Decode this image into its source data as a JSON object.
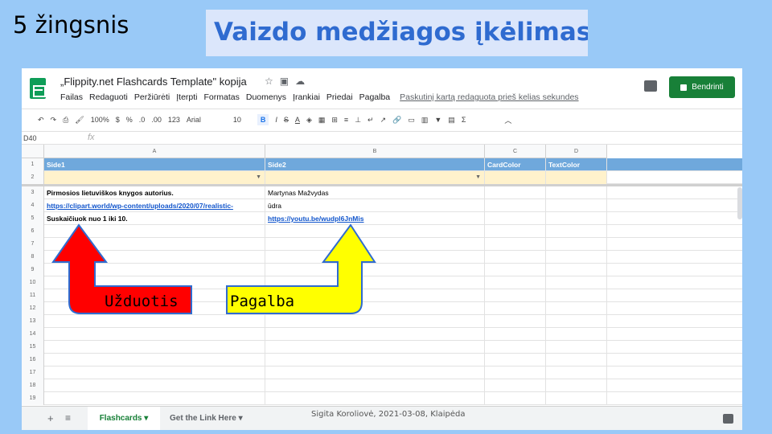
{
  "slide": {
    "step": "5 žingsnis",
    "title": "Vaizdo medžiagos įkėlimas",
    "footer": "Sigita Koroliovė, 2021-03-08, Klaipėda",
    "arrow_left_label": "Užduotis",
    "arrow_right_label": "Pagalba",
    "colors": {
      "background": "#99c9f7",
      "title_box": "#dbe6fb",
      "title_text": "#2f6bd0",
      "arrow_left": "#ff0000",
      "arrow_right": "#ffff00"
    }
  },
  "sheets": {
    "doc_title": "„Flippity.net Flashcards Template\" kopija",
    "title_icons": [
      "star-icon",
      "move-icon",
      "cloud-icon"
    ],
    "menu": [
      "Failas",
      "Redaguoti",
      "Peržiūrėti",
      "Įterpti",
      "Formatas",
      "Duomenys",
      "Įrankiai",
      "Priedai",
      "Pagalba"
    ],
    "last_edit": "Paskutinį kartą redaguota prieš kelias sekundes",
    "share_label": "Bendrinti",
    "toolbar": {
      "zoom": "100%",
      "currency": "$",
      "percent": "%",
      "dec_less": ".0",
      "dec_more": ".00",
      "format_more": "123",
      "font": "Arial",
      "font_size": "10",
      "bold": "B",
      "strike": "S",
      "text_color": "A",
      "sum": "Σ"
    },
    "name_box": "D40",
    "fx": "fx",
    "columns": [
      "A",
      "B",
      "C",
      "D"
    ],
    "header_row": {
      "num": "1",
      "cells": [
        "Side1",
        "Side2",
        "CardColor",
        "TextColor"
      ]
    },
    "rows": [
      {
        "num": "2",
        "cells": [
          "",
          "",
          "",
          ""
        ]
      },
      {
        "num": "3",
        "cells": [
          "Pirmosios lietuviškos knygos autorius.",
          "Martynas Mažvydas",
          "",
          ""
        ]
      },
      {
        "num": "4",
        "cells": [
          "https://clipart.world/wp-content/uploads/2020/07/realistic-",
          "ūdra",
          "",
          ""
        ]
      },
      {
        "num": "5",
        "cells": [
          "Suskaičiuok nuo 1 iki 10.",
          "https://youtu.be/wudpl6JnMis",
          "",
          ""
        ]
      },
      {
        "num": "6",
        "cells": [
          "",
          "",
          "",
          ""
        ]
      },
      {
        "num": "7",
        "cells": [
          "",
          "",
          "",
          ""
        ]
      },
      {
        "num": "8",
        "cells": [
          "",
          "",
          "",
          ""
        ]
      },
      {
        "num": "9",
        "cells": [
          "",
          "",
          "",
          ""
        ]
      },
      {
        "num": "10",
        "cells": [
          "",
          "",
          "",
          ""
        ]
      },
      {
        "num": "11",
        "cells": [
          "",
          "",
          "",
          ""
        ]
      },
      {
        "num": "12",
        "cells": [
          "",
          "",
          "",
          ""
        ]
      },
      {
        "num": "13",
        "cells": [
          "",
          "",
          "",
          ""
        ]
      },
      {
        "num": "14",
        "cells": [
          "",
          "",
          "",
          ""
        ]
      },
      {
        "num": "15",
        "cells": [
          "",
          "",
          "",
          ""
        ]
      },
      {
        "num": "16",
        "cells": [
          "",
          "",
          "",
          ""
        ]
      },
      {
        "num": "17",
        "cells": [
          "",
          "",
          "",
          ""
        ]
      },
      {
        "num": "18",
        "cells": [
          "",
          "",
          "",
          ""
        ]
      },
      {
        "num": "19",
        "cells": [
          "",
          "",
          "",
          ""
        ]
      }
    ],
    "tabs": [
      "Flashcards",
      "Get the Link Here"
    ]
  }
}
